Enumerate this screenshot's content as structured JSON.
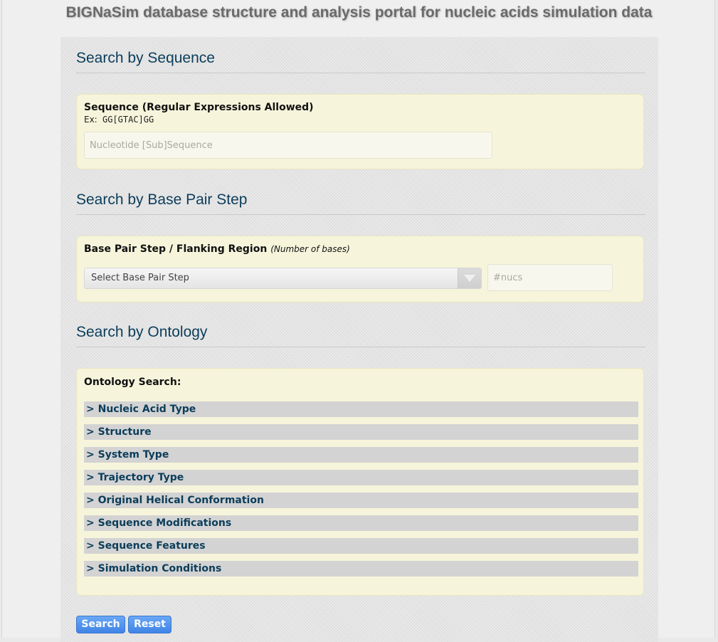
{
  "header": {
    "title": "BIGNaSim database structure and analysis portal for nucleic acids simulation data"
  },
  "sequence": {
    "title": "Search by Sequence",
    "label": "Sequence (Regular Expressions Allowed)",
    "example_key": "Ex:",
    "example_value": "GG[GTAC]GG",
    "input_value": "",
    "input_placeholder": "Nucleotide [Sub]Sequence"
  },
  "basepair": {
    "title": "Search by Base Pair Step",
    "label": "Base Pair Step / Flanking Region",
    "label_note": "(Number of bases)",
    "select_value": "Select Base Pair Step",
    "nucs_value": "",
    "nucs_placeholder": "#nucs"
  },
  "ontology": {
    "title": "Search by Ontology",
    "label": "Ontology Search:",
    "items": [
      "> Nucleic Acid Type",
      "> Structure",
      "> System Type",
      "> Trajectory Type",
      "> Original Helical Conformation",
      "> Sequence Modifications",
      "> Sequence Features",
      "> Simulation Conditions"
    ]
  },
  "buttons": {
    "search": "Search",
    "reset": "Reset"
  },
  "colors": {
    "title_text": "#0b3d5a",
    "card_bg": "#f6f5dc",
    "button_blue": "#4a8ff0"
  }
}
